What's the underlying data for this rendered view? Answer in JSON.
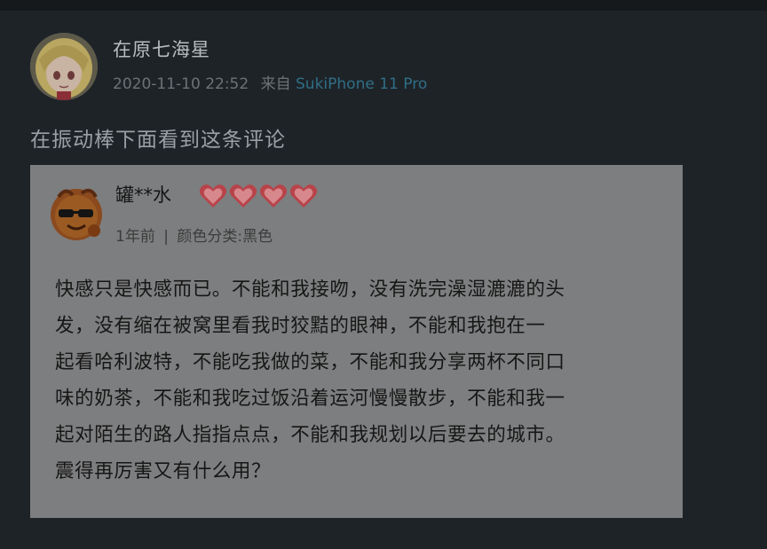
{
  "post": {
    "username": "在原七海星",
    "timestamp": "2020-11-10 22:52",
    "source_prefix": "来自",
    "device": "SukiPhone 11 Pro",
    "text": "在振动棒下面看到这条评论"
  },
  "quoted_comment": {
    "username": "罐**水",
    "heart_count": 4,
    "time": "1年前",
    "separator": "|",
    "variant": "颜色分类:黑色",
    "lines": [
      "快感只是快感而已。不能和我接吻，没有洗完澡湿漉漉的头",
      "发，没有缩在被窝里看我时狡黠的眼神，不能和我抱在一",
      "起看哈利波特，不能吃我做的菜，不能和我分享两杯不同口",
      "味的奶茶，不能和我吃过饭沿着运河慢慢散步，不能和我一",
      "起对陌生的路人指指点点，不能和我规划以后要去的城市。",
      "震得再厉害又有什么用？"
    ]
  },
  "colors": {
    "background": "#1e2328",
    "card": "#7d7e7f",
    "device_link": "#2f6f86",
    "heart": "#b8434a"
  }
}
